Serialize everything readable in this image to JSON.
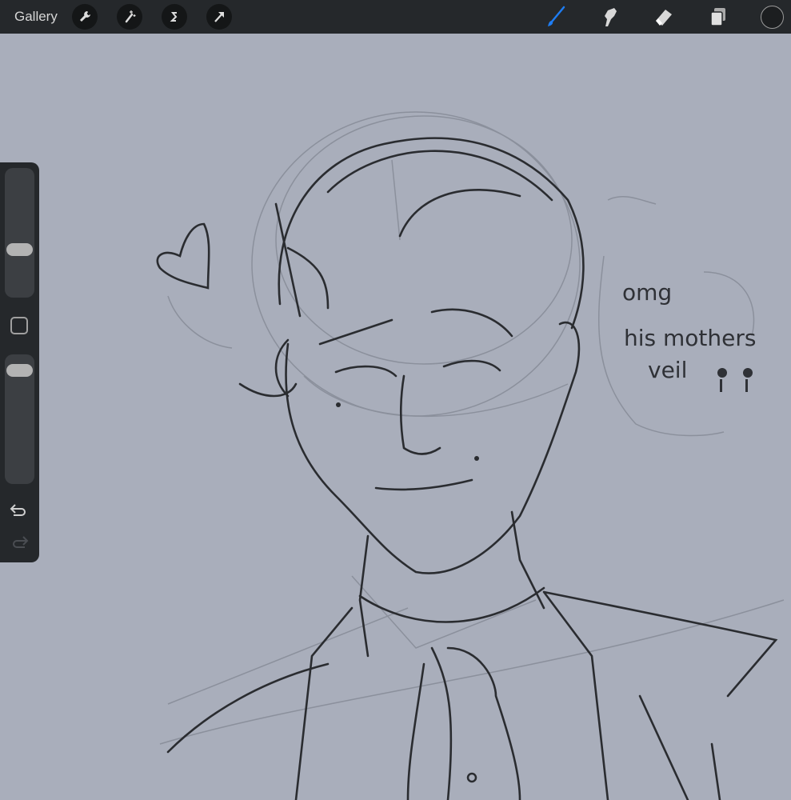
{
  "toolbar": {
    "gallery_label": "Gallery",
    "left_tools": [
      "wrench-icon",
      "magic-wand-icon",
      "selection-icon",
      "transform-arrow-icon"
    ],
    "right_tools": [
      "brush-icon",
      "smudge-icon",
      "eraser-icon",
      "layers-icon",
      "color-icon"
    ],
    "active_tool": "brush",
    "accent_color": "#1e7cf2",
    "current_color": "#1c1e20"
  },
  "sidebar": {
    "brush_size": 0.35,
    "opacity": 0.94
  },
  "canvas": {
    "background": "#a9aebb",
    "handwriting": [
      "omg",
      "his mothers",
      "veil"
    ]
  }
}
